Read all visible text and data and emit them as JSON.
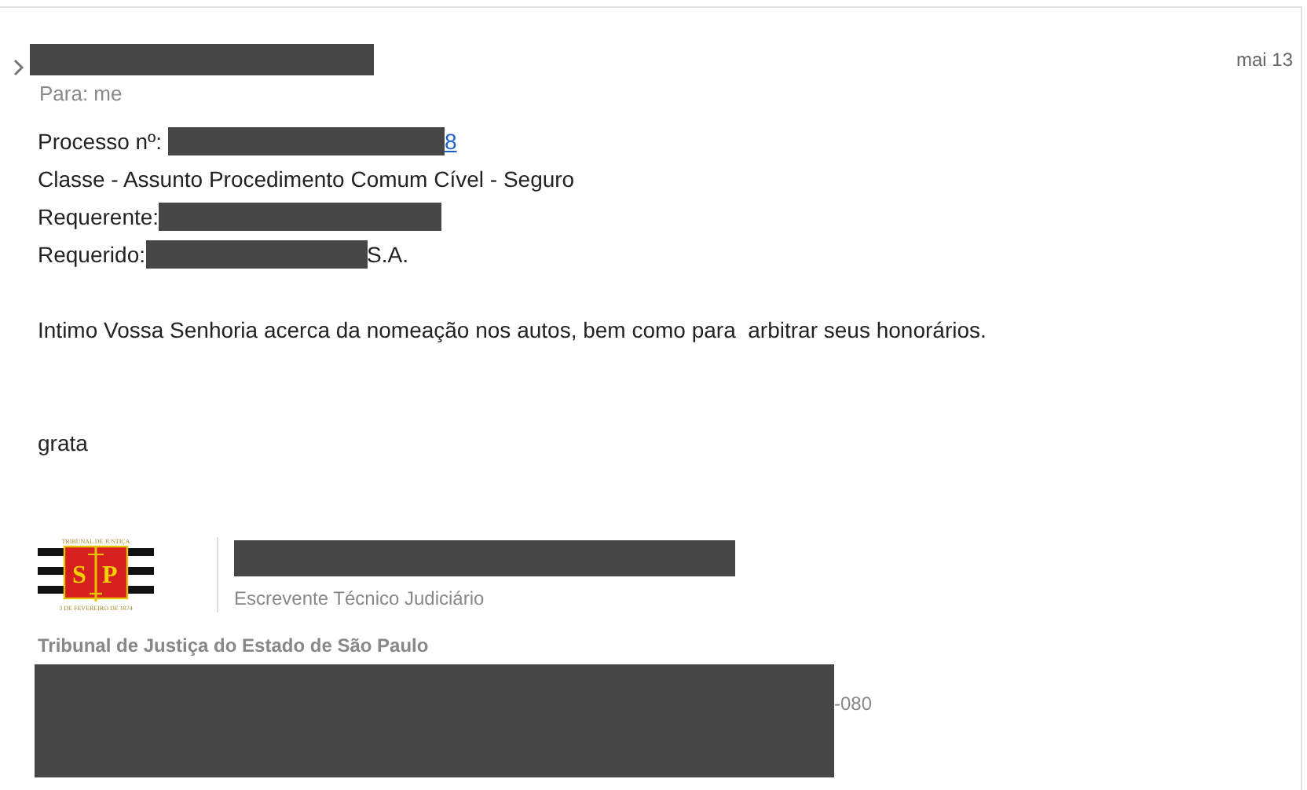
{
  "message": {
    "sender": {
      "kind": "redacted"
    },
    "date": "mai 13",
    "to_line": "Para: me"
  },
  "fields": [
    {
      "segments": [
        {
          "kind": "text",
          "text": "Processo nº: "
        },
        {
          "kind": "redacted"
        },
        {
          "kind": "link",
          "text": "8"
        }
      ]
    },
    {
      "segments": [
        {
          "kind": "text",
          "text": "Classe - Assunto Procedimento Comum Cível - Seguro"
        }
      ]
    },
    {
      "segments": [
        {
          "kind": "text",
          "text": "Requerente:"
        },
        {
          "kind": "redacted"
        }
      ]
    },
    {
      "segments": [
        {
          "kind": "text",
          "text": "Requerido:"
        },
        {
          "kind": "redacted"
        },
        {
          "kind": "text",
          "text": "S.A."
        }
      ]
    }
  ],
  "paragraphs": [
    "Intimo Vossa Senhoria acerca da nomeação nos autos, bem como para  arbitrar seus honorários.",
    "grata"
  ],
  "signature": {
    "logo": {
      "top_caption": "TRIBUNAL DE JUSTIÇA",
      "left_letter": "S",
      "right_letter": "P",
      "bottom_caption": "3 DE FEVEREIRO DE 1874"
    },
    "name": {
      "kind": "redacted"
    },
    "role": "Escrevente Técnico Judiciário",
    "organization": "Tribunal de Justiça do Estado de São Paulo",
    "contact": [
      {
        "kind": "redacted"
      },
      {
        "kind": "text",
        "text": "-080"
      }
    ]
  }
}
